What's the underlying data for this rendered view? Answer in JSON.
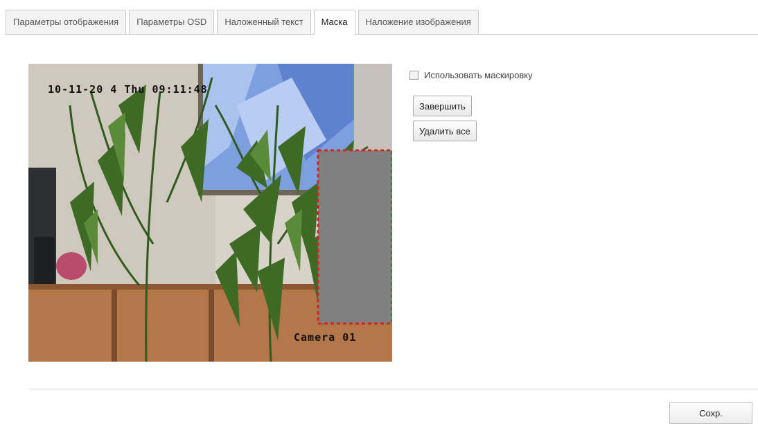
{
  "tabs": [
    {
      "label": "Параметры отображения",
      "active": false
    },
    {
      "label": "Параметры OSD",
      "active": false
    },
    {
      "label": "Наложенный текст",
      "active": false
    },
    {
      "label": "Маска",
      "active": true
    },
    {
      "label": "Наложение изображения",
      "active": false
    }
  ],
  "preview": {
    "osd_datetime": "10-11-20 4 Thu 09:11:48",
    "osd_camera_name": "Camera 01",
    "mask_color": "#808080",
    "mask_border_color": "#d9221c"
  },
  "privacy_mask": {
    "enable_label": "Использовать маскировку",
    "enabled": false,
    "finish_label": "Завершить",
    "delete_all_label": "Удалить все"
  },
  "footer": {
    "save_label": "Сохр."
  }
}
